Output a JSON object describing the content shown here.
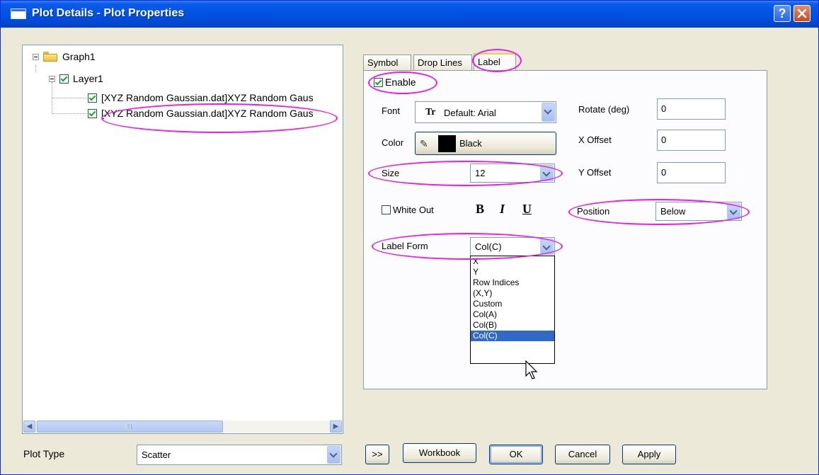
{
  "window": {
    "title": "Plot Details - Plot Properties",
    "help_label": "?"
  },
  "tree": {
    "root_label": "Graph1",
    "layer_label": "Layer1",
    "plot1_label": "[XYZ Random Gaussian.dat]XYZ Random Gaus",
    "plot2_label": "[XYZ Random Gaussian.dat]XYZ Random Gaus",
    "scroll_left": "◀",
    "scroll_right": "▶"
  },
  "tabs": {
    "symbol": "Symbol",
    "drop_lines": "Drop Lines",
    "label": "Label"
  },
  "label_tab": {
    "enable_label": "Enable",
    "enable_checked": true,
    "font_label": "Font",
    "font_icon_text": "Tr",
    "font_value": "Default: Arial",
    "color_label": "Color",
    "color_value": "Black",
    "color_swatch": "#000000",
    "size_label": "Size",
    "size_value": "12",
    "white_out_label": "White Out",
    "white_out_checked": false,
    "bold_label": "B",
    "italic_label": "I",
    "underline_label": "U",
    "label_form_label": "Label Form",
    "label_form_value": "Col(C)",
    "label_form_options": [
      "X",
      "Y",
      "Row Indices",
      "(X,Y)",
      "Custom",
      "Col(A)",
      "Col(B)",
      "Col(C)"
    ],
    "label_form_selected": "Col(C)",
    "rotate_label": "Rotate (deg)",
    "rotate_value": "0",
    "x_offset_label": "X Offset",
    "x_offset_value": "0",
    "y_offset_label": "Y Offset",
    "y_offset_value": "0",
    "position_label": "Position",
    "position_value": "Below"
  },
  "bottom": {
    "plot_type_label": "Plot Type",
    "plot_type_value": "Scatter",
    "expand_label": ">>",
    "workbook_label": "Workbook",
    "ok_label": "OK",
    "cancel_label": "Cancel",
    "apply_label": "Apply"
  },
  "colors": {
    "highlight_ring": "#e61ee6",
    "selection": "#316ac5",
    "titlebar": "#0054e3"
  }
}
